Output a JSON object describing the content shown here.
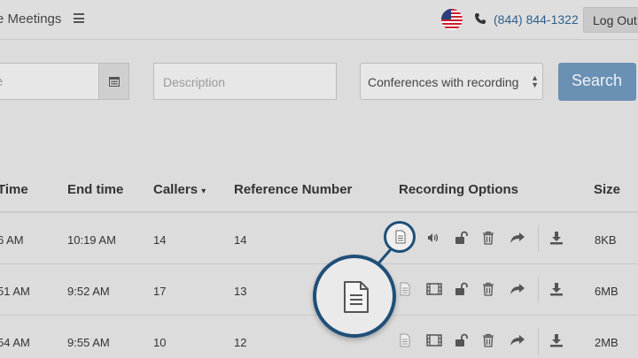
{
  "header": {
    "app_title": "e Meetings",
    "phone": "(844) 844-1322",
    "logout_label": "Log Out"
  },
  "search": {
    "date_placeholder": "e",
    "description_placeholder": "Description",
    "filter_selected": "Conferences with recording",
    "search_label": "Search"
  },
  "table": {
    "headers": {
      "start_time": "Time",
      "end_time": "End time",
      "callers": "Callers",
      "callers_sort": "▾",
      "reference": "Reference Number",
      "recording_options": "Recording Options",
      "size": "Size"
    },
    "rows": [
      {
        "start": "6 AM",
        "end": "10:19 AM",
        "callers": "14",
        "reference": "14",
        "size": "8KB",
        "media": "audio"
      },
      {
        "start": "51 AM",
        "end": "9:52 AM",
        "callers": "17",
        "reference": "13",
        "size": "6MB",
        "media": "video"
      },
      {
        "start": "54 AM",
        "end": "9:55 AM",
        "callers": "10",
        "reference": "12",
        "size": "2MB",
        "media": "video"
      }
    ]
  },
  "icons": {
    "menu": "hamburger-icon",
    "flag": "us-flag-icon",
    "phone": "phone-icon",
    "calendar": "calendar-icon",
    "transcript": "document-icon",
    "audio": "speaker-icon",
    "video": "film-icon",
    "unlock": "unlock-icon",
    "delete": "trash-icon",
    "share": "share-arrow-icon",
    "download": "download-icon"
  },
  "colors": {
    "accent_blue": "#2c5f8c",
    "search_button": "#6a90b4",
    "callout_border": "#1f4f78"
  }
}
